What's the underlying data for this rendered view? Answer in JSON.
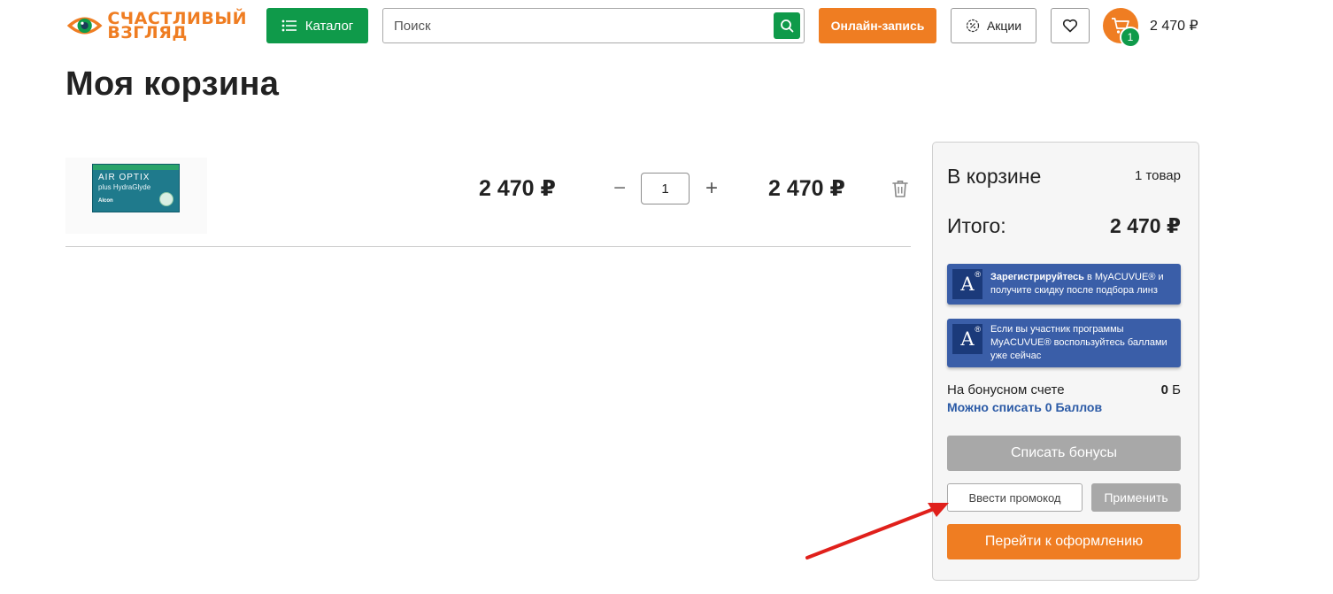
{
  "header": {
    "logo": {
      "line1": "СЧАСТЛИВЫЙ",
      "line2": "ВЗГЛЯД",
      "icon": "eye-logo-icon"
    },
    "catalog_label": "Каталог",
    "search_placeholder": "Поиск",
    "online_booking_label": "Онлайн-запись",
    "promotions_label": "Акции",
    "cart_badge_count": "1",
    "cart_total": "2 470 ₽"
  },
  "page": {
    "title": "Моя корзина"
  },
  "cart_item": {
    "image_alt": "AIR OPTIX plus HydraGlyde",
    "pack_line1": "AIR OPTIX",
    "pack_line2": "plus HydraGlyde",
    "pack_brand": "Alcon",
    "unit_price": "2 470 ₽",
    "minus": "−",
    "quantity": "1",
    "plus": "+",
    "total_price": "2 470 ₽"
  },
  "summary": {
    "title": "В корзине",
    "count": "1 товар",
    "total_label": "Итого:",
    "total_value": "2 470 ₽",
    "acuvue_logo": "A",
    "acuvue_reg": "®",
    "acuvue1_bold": "Зарегистрируйтесь",
    "acuvue1_rest": "в MyACUVUE® и получите скидку после подбора линз",
    "acuvue2_text": "Если вы участник программы MyACUVUE® воспользуйтесь баллами уже сейчас",
    "bonus_label": "На бонусном счете",
    "bonus_value": "0",
    "bonus_unit": "Б",
    "bonus_link": "Можно списать 0 Баллов",
    "write_off_label": "Списать бонусы",
    "promo_placeholder": "Ввести промокод",
    "apply_label": "Применить",
    "checkout_label": "Перейти к оформлению"
  },
  "colors": {
    "brand_orange": "#ef7d22",
    "brand_green": "#0f9a4a",
    "acuvue_blue": "#3a5ea8",
    "disabled_gray": "#a8a8a8",
    "link_blue": "#2b5aa6",
    "annotation_red": "#e0201b"
  }
}
